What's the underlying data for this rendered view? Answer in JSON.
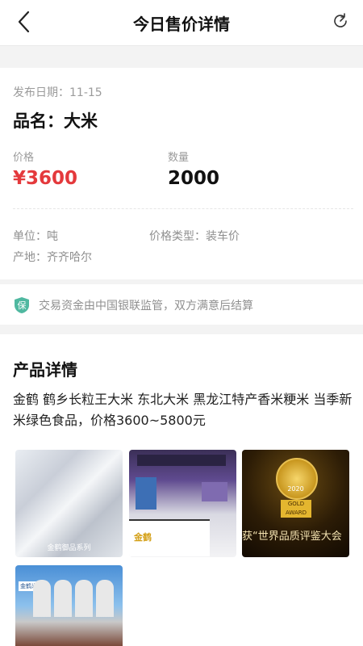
{
  "header": {
    "title": "今日售价详情",
    "back_icon": "chevron-left-icon",
    "refresh_icon": "refresh-icon"
  },
  "listing": {
    "date": "发布日期：11-15",
    "name": "品名：大米",
    "price_label": "价格",
    "price": "¥3600",
    "qty_label": "数量",
    "qty": "2000",
    "unit": "单位：吨",
    "price_type": "价格类型：装车价",
    "origin": "产地：齐齐哈尔"
  },
  "notice": {
    "icon": "shield-icon",
    "icon_text": "保",
    "text": "交易资金由中国银联监管，双方满意后结算"
  },
  "details": {
    "title": "产品详情",
    "description": "金鹤 鹤乡长粒王大米 东北大米 黑龙江特产香米粳米 当季新米绿色食品，价格3600~5800元",
    "images": [
      {
        "caption": "金鹤御品系列"
      },
      {
        "caption": "金鹤"
      },
      {
        "caption": "获“世界品质评鉴大会",
        "year": "SINCE 1961",
        "badge": "GOLD AWARD",
        "badge_year": "2020"
      },
      {
        "caption": "金鹤米业"
      }
    ]
  },
  "colors": {
    "price": "#e4393c",
    "shield": "#4fb8a0"
  }
}
